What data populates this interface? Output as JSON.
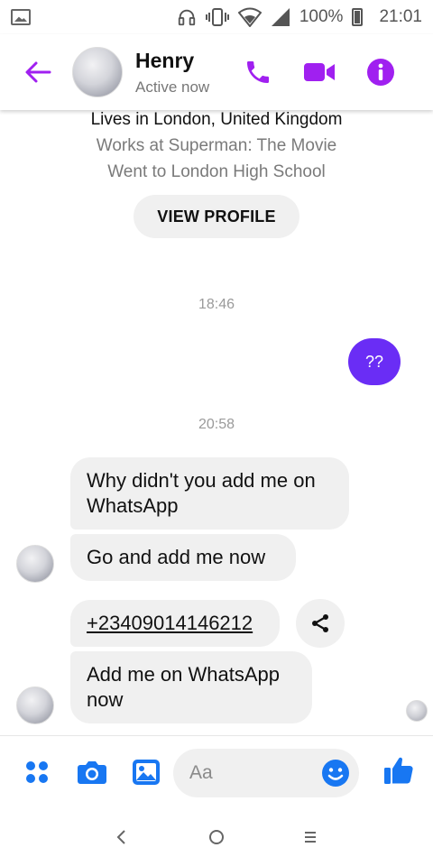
{
  "status_bar": {
    "battery_text": "100%",
    "time": "21:01"
  },
  "header": {
    "contact_name": "Henry",
    "contact_status": "Active now"
  },
  "profile": {
    "lives": "Lives in London, United Kingdom",
    "works": "Works at Superman: The Movie",
    "school": "Went to London High School",
    "view_profile_label": "VIEW PROFILE"
  },
  "messages": {
    "time_1": "18:46",
    "outgoing_1": "??",
    "time_2": "20:58",
    "incoming": [
      "Why didn't you add me on WhatsApp",
      "Go and add me now",
      "+23409014146212",
      "Add me on WhatsApp now"
    ]
  },
  "composer": {
    "placeholder": "Aa"
  },
  "colors": {
    "accent": "#a020f0",
    "bubble_out": "#6a2df5",
    "composer_icon": "#1877f2"
  },
  "icons": [
    "back-arrow-icon",
    "phone-icon",
    "video-call-icon",
    "info-icon",
    "share-icon",
    "menu-dots-icon",
    "camera-icon",
    "gallery-icon",
    "emoji-icon",
    "thumbs-up-icon"
  ]
}
